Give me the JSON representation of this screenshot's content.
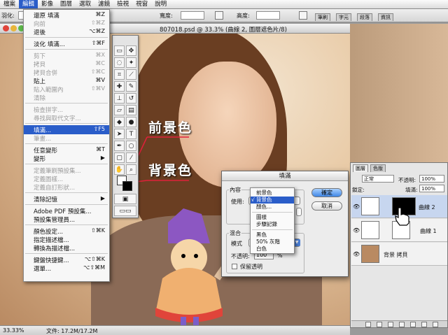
{
  "menubar": {
    "items": [
      "檔案",
      "編輯",
      "影像",
      "圖層",
      "選取",
      "濾鏡",
      "檢視",
      "視窗",
      "說明"
    ],
    "active_index": 1
  },
  "options": {
    "feather_label": "羽化:",
    "width_label": "寬度:",
    "height_label": "高度:",
    "palette_tabs": [
      "筆刷",
      "字元",
      "段落",
      "資訊"
    ]
  },
  "document": {
    "title": "807018.psd @ 33.3% (曲線 2, 圖層遮色片/8)"
  },
  "edit_menu": {
    "items": [
      {
        "label": "還原 填滿",
        "key": "⌘Z",
        "state": "enabled"
      },
      {
        "label": "向前",
        "key": "⇧⌘Z",
        "state": "disabled"
      },
      {
        "label": "退後",
        "key": "⌥⌘Z",
        "state": "enabled"
      },
      {
        "sep": true
      },
      {
        "label": "淡化 填滿...",
        "key": "⇧⌘F",
        "state": "enabled"
      },
      {
        "sep": true
      },
      {
        "label": "剪下",
        "key": "⌘X",
        "state": "disabled"
      },
      {
        "label": "拷貝",
        "key": "⌘C",
        "state": "disabled"
      },
      {
        "label": "拷貝合併",
        "key": "⇧⌘C",
        "state": "disabled"
      },
      {
        "label": "貼上",
        "key": "⌘V",
        "state": "enabled"
      },
      {
        "label": "貼入範圍內",
        "key": "⇧⌘V",
        "state": "disabled"
      },
      {
        "label": "清除",
        "key": "",
        "state": "disabled"
      },
      {
        "sep": true
      },
      {
        "label": "檢查拼字...",
        "key": "",
        "state": "disabled"
      },
      {
        "label": "尋找與取代文字...",
        "key": "",
        "state": "disabled"
      },
      {
        "sep": true
      },
      {
        "label": "填滿...",
        "key": "⇧F5",
        "state": "selected"
      },
      {
        "label": "筆畫...",
        "key": "",
        "state": "disabled"
      },
      {
        "sep": true
      },
      {
        "label": "任意變形",
        "key": "⌘T",
        "state": "enabled"
      },
      {
        "label": "變形",
        "key": "▶",
        "state": "enabled"
      },
      {
        "sep": true
      },
      {
        "label": "定義筆刷預設集...",
        "key": "",
        "state": "disabled"
      },
      {
        "label": "定義圖樣...",
        "key": "",
        "state": "disabled"
      },
      {
        "label": "定義自訂形狀...",
        "key": "",
        "state": "disabled"
      },
      {
        "sep": true
      },
      {
        "label": "清除記憶",
        "key": "▶",
        "state": "enabled"
      },
      {
        "sep": true
      },
      {
        "label": "Adobe PDF 預設集...",
        "key": "",
        "state": "enabled"
      },
      {
        "label": "預設集管理員...",
        "key": "",
        "state": "enabled"
      },
      {
        "sep": true
      },
      {
        "label": "顏色設定...",
        "key": "⇧⌘K",
        "state": "enabled"
      },
      {
        "label": "指定描述檔...",
        "key": "",
        "state": "enabled"
      },
      {
        "label": "轉換為描述檔...",
        "key": "",
        "state": "enabled"
      },
      {
        "sep": true
      },
      {
        "label": "鍵盤快捷鍵...",
        "key": "⌥⇧⌘K",
        "state": "enabled"
      },
      {
        "label": "選單...",
        "key": "⌥⇧⌘M",
        "state": "enabled"
      }
    ]
  },
  "callouts": {
    "foreground": "前景色",
    "background": "背景色"
  },
  "fill_dialog": {
    "title": "填滿",
    "contents_group": "內容",
    "use_label": "使用:",
    "blending_group": "混合",
    "mode_label": "模式",
    "opacity_label": "不透明:",
    "opacity_value": "100",
    "opacity_unit": "%",
    "preserve_label": "保留透明",
    "ok": "確定",
    "cancel": "取消"
  },
  "dropdown": {
    "options": [
      {
        "label": "前景色",
        "selected": false
      },
      {
        "label": "背景色",
        "selected": true,
        "check": "√"
      },
      {
        "label": "顏色...",
        "selected": false
      },
      {
        "sep": true
      },
      {
        "label": "圖樣",
        "selected": false
      },
      {
        "label": "步驟記錄",
        "selected": false
      },
      {
        "sep": true
      },
      {
        "label": "黑色",
        "selected": false
      },
      {
        "label": "50% 灰階",
        "selected": false
      },
      {
        "label": "白色",
        "selected": false
      }
    ]
  },
  "layers": {
    "tabs": [
      "圖層",
      "色版"
    ],
    "blend_mode": "正常",
    "opacity_label": "不透明:",
    "opacity": "100%",
    "lock_label": "鎖定:",
    "fill_label": "填滿:",
    "fill": "100%",
    "items": [
      {
        "name": "曲線 2",
        "selected": true
      },
      {
        "name": "曲線 1",
        "selected": false
      },
      {
        "name": "背景 拷貝",
        "selected": false
      }
    ]
  },
  "status": {
    "zoom": "33.33%",
    "doc_size": "文件: 17.2M/17.2M"
  },
  "colors": {
    "menu_highlight": "#2a5dc9",
    "close_red": "#e0443a",
    "minimize_yellow": "#e8b53a",
    "zoom_green": "#5cb848"
  }
}
